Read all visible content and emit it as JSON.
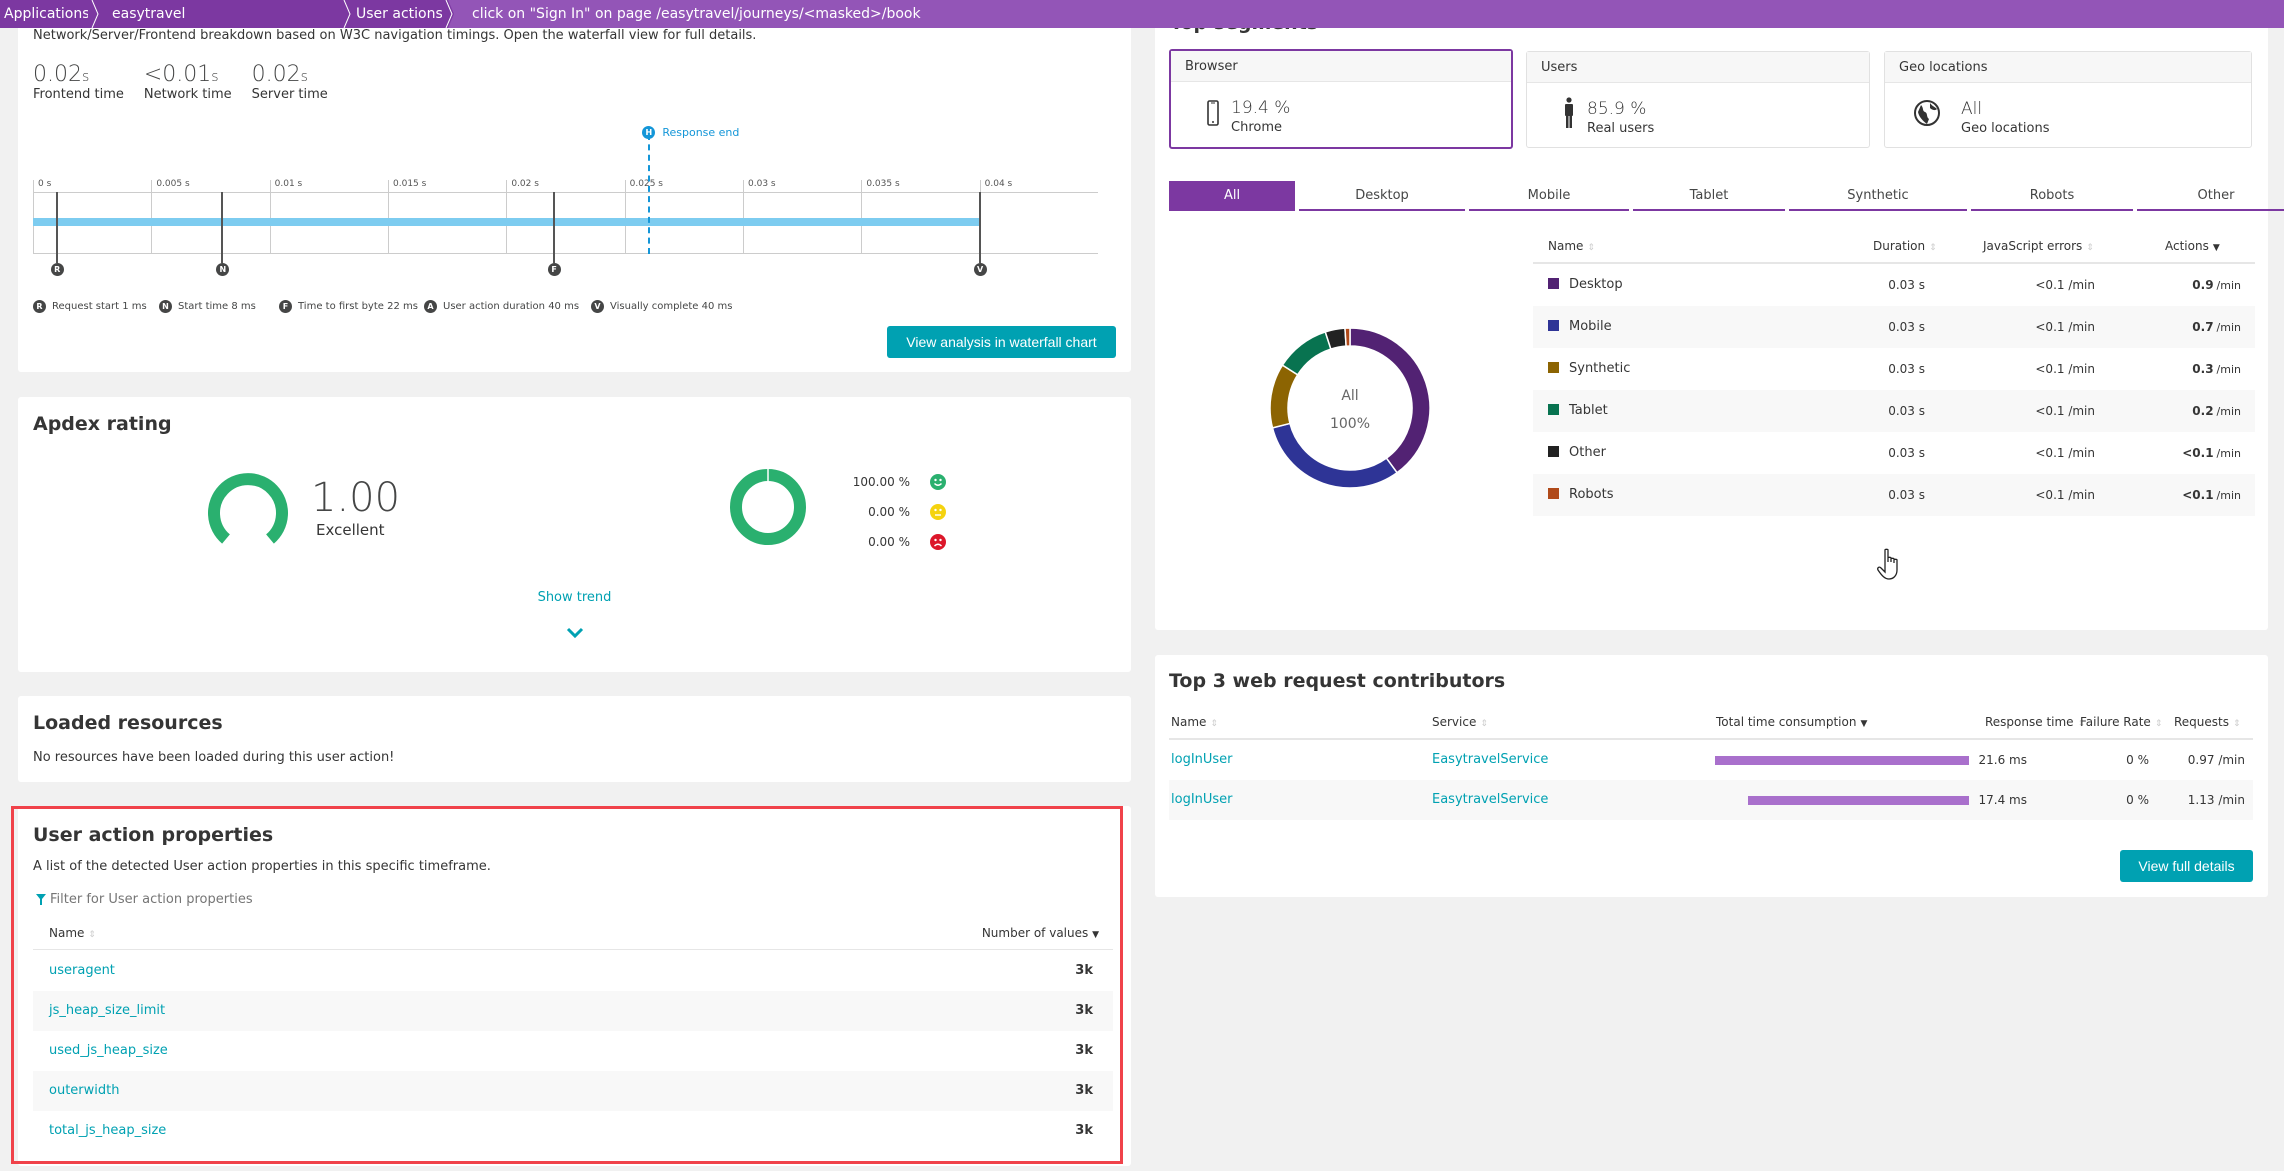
{
  "breadcrumb": {
    "items": [
      "Applications",
      "easytravel",
      "User actions",
      "click on \"Sign In\" on page /easytravel/journeys/<masked>/book"
    ]
  },
  "colors": {
    "accent": "#7c38a1",
    "breadcrumb": "#9355b7",
    "teal": "#00a1b2",
    "apdex_green": "#2ab06f",
    "highlight_outline": "#f0424a"
  },
  "waterfall": {
    "description": "Network/Server/Frontend breakdown based on W3C navigation timings. Open the waterfall view for full details.",
    "timings": [
      {
        "value": "0.02",
        "unit": "s",
        "label": "Frontend time"
      },
      {
        "value": "<0.01",
        "unit": "s",
        "label": "Network time"
      },
      {
        "value": "0.02",
        "unit": "s",
        "label": "Server time"
      }
    ],
    "axis_ticks": [
      "0 s",
      "0.005 s",
      "0.01 s",
      "0.015 s",
      "0.02 s",
      "0.025 s",
      "0.03 s",
      "0.035 s",
      "0.04 s"
    ],
    "axis_max_s": 0.045,
    "response_end": {
      "letter": "H",
      "label": "Response end",
      "time_s": 0.026
    },
    "bar_end_s": 0.04,
    "markers": [
      {
        "letter": "R",
        "time_s": 0.001
      },
      {
        "letter": "N",
        "time_s": 0.008
      },
      {
        "letter": "F",
        "time_s": 0.022
      },
      {
        "letter": "V",
        "time_s": 0.04
      }
    ],
    "legend": [
      {
        "letter": "R",
        "label": "Request start 1 ms"
      },
      {
        "letter": "N",
        "label": "Start time 8 ms"
      },
      {
        "letter": "F",
        "label": "Time to first byte 22 ms"
      },
      {
        "letter": "A",
        "label": "User action duration 40 ms"
      },
      {
        "letter": "V",
        "label": "Visually complete 40 ms"
      }
    ],
    "button_label": "View analysis in waterfall chart"
  },
  "apdex": {
    "title": "Apdex rating",
    "score": "1.00",
    "rating": "Excellent",
    "score_fraction": 1.0,
    "breakdown": [
      {
        "percent": "100.00 %",
        "mood": "satisfied",
        "color": "#2ab06f",
        "fraction": 1.0
      },
      {
        "percent": "0.00 %",
        "mood": "tolerating",
        "color": "#f5d30f",
        "fraction": 0.0
      },
      {
        "percent": "0.00 %",
        "mood": "frustrated",
        "color": "#dc172a",
        "fraction": 0.0
      }
    ],
    "show_trend": "Show trend"
  },
  "loaded_resources": {
    "title": "Loaded resources",
    "message": "No resources have been loaded during this user action!"
  },
  "user_action_properties": {
    "title": "User action properties",
    "description": "A list of the detected User action properties in this specific timeframe.",
    "filter_placeholder": "Filter for User action properties",
    "columns": [
      "Name",
      "Number of values"
    ],
    "rows": [
      {
        "name": "useragent",
        "count": "3k"
      },
      {
        "name": "js_heap_size_limit",
        "count": "3k"
      },
      {
        "name": "used_js_heap_size",
        "count": "3k"
      },
      {
        "name": "outerwidth",
        "count": "3k"
      },
      {
        "name": "total_js_heap_size",
        "count": "3k"
      }
    ]
  },
  "top_segments": {
    "title": "Top segments",
    "cards": [
      {
        "header": "Browser",
        "value": "19.4 %",
        "sub": "Chrome",
        "icon": "mobile-phone-icon"
      },
      {
        "header": "Users",
        "value": "85.9 %",
        "sub": "Real users",
        "icon": "person-icon"
      },
      {
        "header": "Geo locations",
        "value": "All",
        "sub": "Geo locations",
        "icon": "globe-icon"
      }
    ],
    "tabs": [
      "All",
      "Desktop",
      "Mobile",
      "Tablet",
      "Synthetic",
      "Robots",
      "Other"
    ],
    "active_tab": "All",
    "donut_center": {
      "label": "All",
      "value": "100%"
    },
    "columns": [
      "Name",
      "Duration",
      "JavaScript errors",
      "Actions"
    ],
    "rows": [
      {
        "name": "Desktop",
        "color": "#522273",
        "duration": "0.03 s",
        "js_errors": "<0.1 /min",
        "actions_value": "0.9",
        "actions_unit": "/min",
        "share": 0.4
      },
      {
        "name": "Mobile",
        "color": "#2e3496",
        "duration": "0.03 s",
        "js_errors": "<0.1 /min",
        "actions_value": "0.7",
        "actions_unit": "/min",
        "share": 0.31
      },
      {
        "name": "Synthetic",
        "color": "#8c6402",
        "duration": "0.03 s",
        "js_errors": "<0.1 /min",
        "actions_value": "0.3",
        "actions_unit": "/min",
        "share": 0.13
      },
      {
        "name": "Tablet",
        "color": "#087350",
        "duration": "0.03 s",
        "js_errors": "<0.1 /min",
        "actions_value": "0.2",
        "actions_unit": "/min",
        "share": 0.11
      },
      {
        "name": "Other",
        "color": "#222222",
        "duration": "0.03 s",
        "js_errors": "<0.1 /min",
        "actions_value": "<0.1",
        "actions_unit": "/min",
        "share": 0.04
      },
      {
        "name": "Robots",
        "color": "#b04a1a",
        "duration": "0.03 s",
        "js_errors": "<0.1 /min",
        "actions_value": "<0.1",
        "actions_unit": "/min",
        "share": 0.01
      }
    ]
  },
  "web_requests": {
    "title": "Top 3 web request contributors",
    "columns": [
      "Name",
      "Service",
      "Total time consumption",
      "Response time",
      "Failure Rate",
      "Requests"
    ],
    "rows": [
      {
        "name": "logInUser",
        "service": "EasytravelService",
        "consumption": 1.0,
        "response_time": "21.6 ms",
        "failure_rate": "0 %",
        "requests": "0.97 /min"
      },
      {
        "name": "logInUser",
        "service": "EasytravelService",
        "consumption": 0.87,
        "response_time": "17.4 ms",
        "failure_rate": "0 %",
        "requests": "1.13 /min"
      }
    ],
    "button_label": "View full details"
  }
}
